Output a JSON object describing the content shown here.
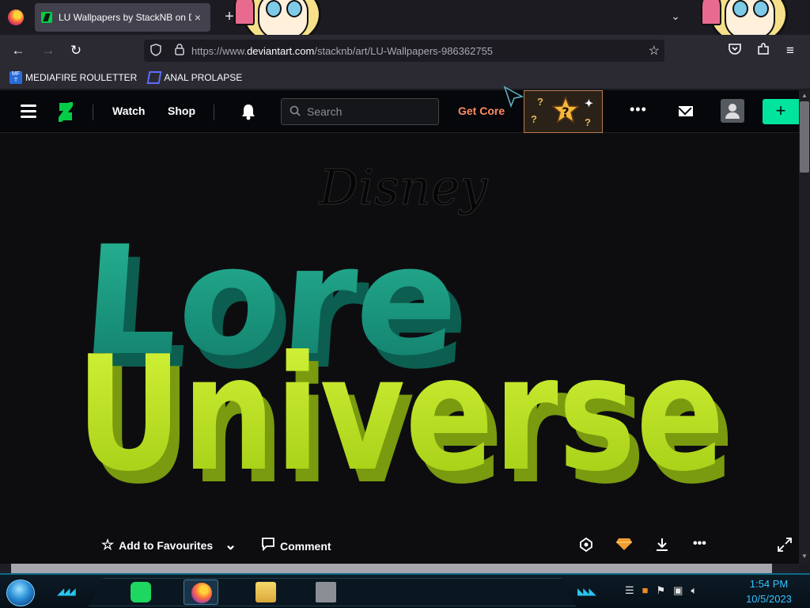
{
  "browser": {
    "tab": {
      "title": "LU Wallpapers by StackNB on D",
      "close_icon": "×"
    },
    "new_tab_label": "+",
    "url": {
      "prefix": "https://www.",
      "domain": "deviantart.com",
      "path": "/stacknb/art/LU-Wallpapers-986362755"
    },
    "bookmarks": [
      {
        "label": "MEDIAFIRE ROULETTER",
        "icon_text": "MF T"
      },
      {
        "label": "ANAL PROLAPSE"
      }
    ]
  },
  "site": {
    "nav": {
      "watch": "Watch",
      "shop": "Shop"
    },
    "search_placeholder": "Search",
    "get_core": "Get Core",
    "submit_label": "+"
  },
  "artwork": {
    "brand": "Disney",
    "line1": "Lore",
    "line2": "Universe",
    "colors": {
      "lore": "#1fa58a",
      "universe": "#c6ee2a"
    }
  },
  "actions": {
    "favourite": "Add to Favourites",
    "comment": "Comment"
  },
  "taskbar": {
    "time": "1:54 PM",
    "date": "10/5/2023"
  }
}
